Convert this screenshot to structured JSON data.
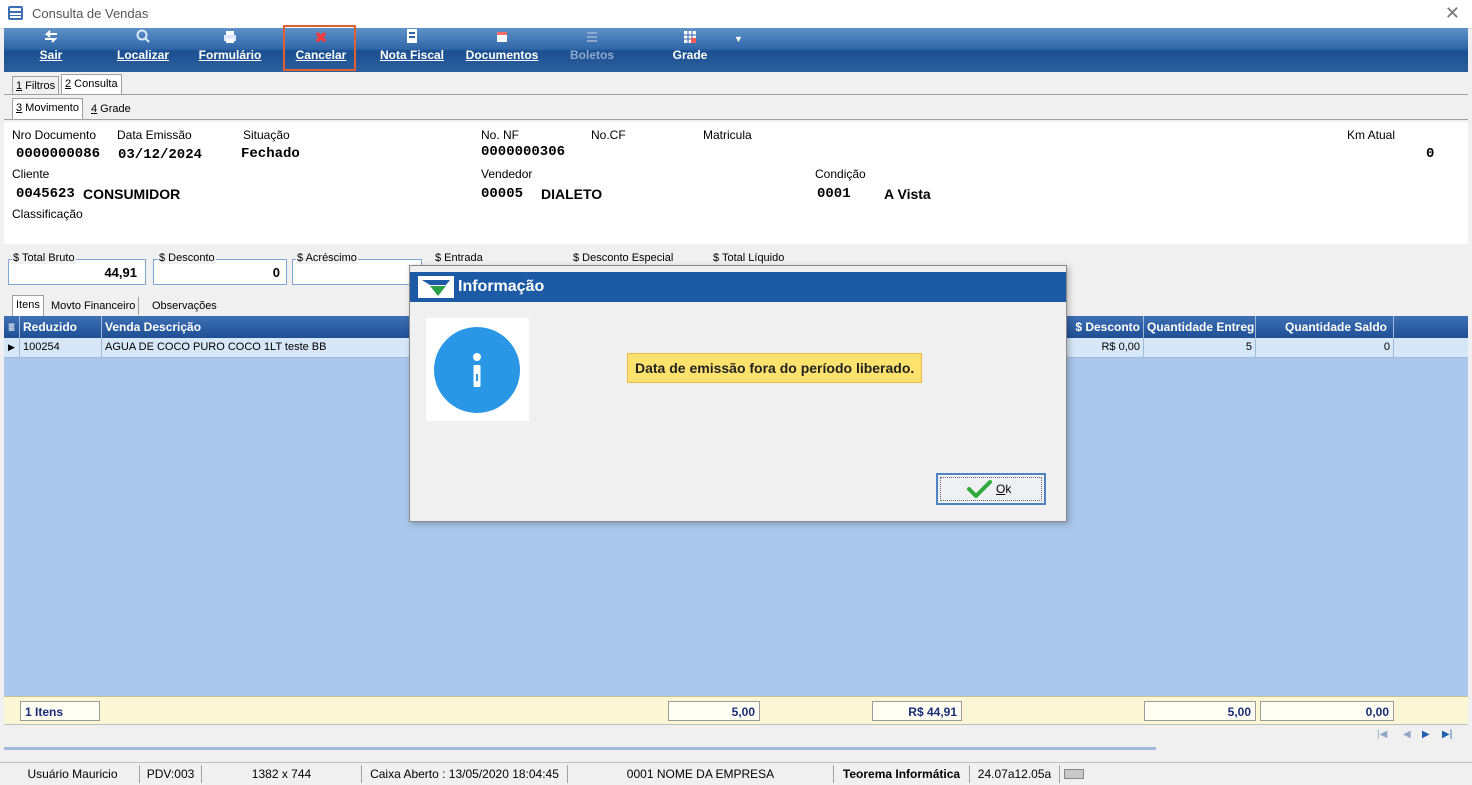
{
  "window": {
    "title": "Consulta de Vendas",
    "close_glyph": "✕"
  },
  "toolbar": {
    "buttons": [
      {
        "label": "Sair",
        "icon": "exit-icon"
      },
      {
        "label": "Localizar",
        "icon": "search-icon"
      },
      {
        "label": "Formulário",
        "icon": "printer-icon"
      },
      {
        "label": "Cancelar",
        "icon": "cancel-x-icon"
      },
      {
        "label": "Nota Fiscal",
        "icon": "invoice-icon"
      },
      {
        "label": "Documentos",
        "icon": "documents-icon"
      },
      {
        "label": "Boletos",
        "icon": "boletos-icon"
      },
      {
        "label": "Grade",
        "icon": "grid-icon"
      }
    ],
    "more_glyph": "▼"
  },
  "tabs_top": [
    {
      "key": "1",
      "rest": " Filtros"
    },
    {
      "key": "2",
      "rest": " Consulta"
    }
  ],
  "tabs_sub": [
    {
      "key": "3",
      "rest": " Movimento"
    },
    {
      "key": "4",
      "rest": " Grade"
    }
  ],
  "header": {
    "nro_documento_label": "Nro Documento",
    "nro_documento": "0000000086",
    "data_emissao_label": "Data Emissão",
    "data_emissao": "03/12/2024",
    "situacao_label": "Situação",
    "situacao": "Fechado",
    "no_nf_label": "No. NF",
    "no_nf": "0000000306",
    "no_cf_label": "No.CF",
    "matricula_label": "Matricula",
    "km_atual_label": "Km Atual",
    "km_atual": "0",
    "cliente_label": "Cliente",
    "cliente_codigo": "0045623",
    "cliente_nome": "CONSUMIDOR",
    "vendedor_label": "Vendedor",
    "vendedor_codigo": "00005",
    "vendedor_nome": "DIALETO",
    "condicao_label": "Condição",
    "condicao_codigo": "0001",
    "condicao_nome": "A Vista",
    "classificacao_label": "Classificação"
  },
  "totals": {
    "total_bruto_label": "$ Total Bruto",
    "total_bruto": "44,91",
    "desconto_label": "$ Desconto",
    "desconto": "0",
    "acrescimo_label": "$ Acréscimo",
    "entrada_label": "$ Entrada",
    "desconto_especial_label": "$ Desconto Especial",
    "total_liquido_label": "$ Total Líquido"
  },
  "tabs_bottom": [
    "Itens",
    "Movto Financeiro",
    "Observações"
  ],
  "grid": {
    "columns": [
      "Reduzido",
      "Venda Descrição",
      "$ Desconto",
      "Quantidade Entreg",
      "Quantidade Saldo"
    ],
    "rows": [
      {
        "reduzido": "100254",
        "descricao": "AGUA DE COCO PURO COCO 1LT teste BB",
        "desconto": "R$ 0,00",
        "qtd_entregue": "5",
        "qtd_saldo": "0"
      }
    ]
  },
  "footer": {
    "itens": "1 Itens",
    "quantidade": "5,00",
    "valor": "R$ 44,91",
    "entregue": "5,00",
    "saldo": "0,00"
  },
  "nav": {
    "first": "|◀",
    "prev": "◀",
    "next": "▶",
    "last": "▶|"
  },
  "statusbar": {
    "usuario": "Usuário Mauricio",
    "pdv": "PDV:003",
    "resolucao": "1382 x 744",
    "caixa": "Caixa Aberto : 13/05/2020 18:04:45",
    "empresa": "0001 NOME DA EMPRESA",
    "fabricante": "Teorema Informática",
    "versao": "24.07a12.05a"
  },
  "dialog": {
    "title": "Informação",
    "message": "Data de emissão fora do período liberado.",
    "ok_key": "O",
    "ok_rest": "k",
    "colors": {
      "title_bar": "#1c5aa6",
      "info_icon": "#2a96e6",
      "message_bg": "#fde36e"
    }
  }
}
